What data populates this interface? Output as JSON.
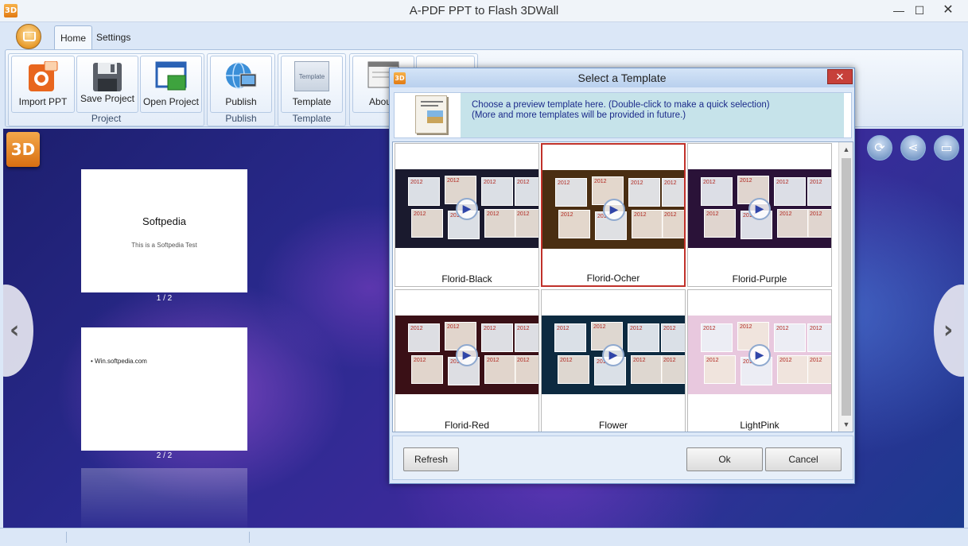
{
  "window": {
    "title": "A-PDF PPT to Flash 3DWall",
    "icon_text": "3D",
    "minimize_glyph": "—",
    "maximize_glyph": "☐",
    "close_glyph": "✕"
  },
  "ribbon": {
    "tabs": [
      {
        "label": "Home",
        "active": true
      },
      {
        "label": "Settings",
        "active": false
      }
    ],
    "groups": [
      {
        "label": "Project",
        "buttons": [
          "Import PPT",
          "Save Project",
          "Open Project"
        ]
      },
      {
        "label": "Publish",
        "buttons": [
          "Publish"
        ]
      },
      {
        "label": "Template",
        "buttons": [
          "Template"
        ]
      },
      {
        "label": "",
        "buttons": [
          "Abou"
        ]
      }
    ],
    "template_icon_text": "Template"
  },
  "canvas": {
    "logo_text": "3D",
    "slides": [
      {
        "title": "Softpedia",
        "subtitle": "This is a Softpedia Test",
        "page": "1 / 2"
      },
      {
        "bullet": "• Win.softpedia.com",
        "page": "2 / 2"
      }
    ],
    "nav": {
      "prev": "‹",
      "next": "›"
    },
    "tools": [
      {
        "icon": "refresh-icon",
        "glyph": "⟳"
      },
      {
        "icon": "share-icon",
        "glyph": "⋖"
      },
      {
        "icon": "monitor-icon",
        "glyph": "▭"
      }
    ]
  },
  "dialog": {
    "title": "Select a Template",
    "icon_text": "3D",
    "close_glyph": "✕",
    "info_line1": "Choose a preview template here. (Double-click to make a quick selection)",
    "info_line2": "(More and more templates will be provided in future.)",
    "templates": [
      {
        "name": "Florid-Black",
        "selected": false,
        "bg": "#1a1a2e"
      },
      {
        "name": "Florid-Ocher",
        "selected": true,
        "bg": "#4a2e12"
      },
      {
        "name": "Florid-Purple",
        "selected": false,
        "bg": "#2a1238"
      },
      {
        "name": "Florid-Red",
        "selected": false,
        "bg": "#3a1016"
      },
      {
        "name": "Flower",
        "selected": false,
        "bg": "#0d2a40"
      },
      {
        "name": "LightPink",
        "selected": false,
        "bg": "#e8c8de"
      }
    ],
    "calendar_year": "2012",
    "play_glyph": "▶",
    "scroll_up": "▲",
    "scroll_down": "▼",
    "buttons": {
      "refresh": "Refresh",
      "ok": "Ok",
      "cancel": "Cancel"
    }
  }
}
